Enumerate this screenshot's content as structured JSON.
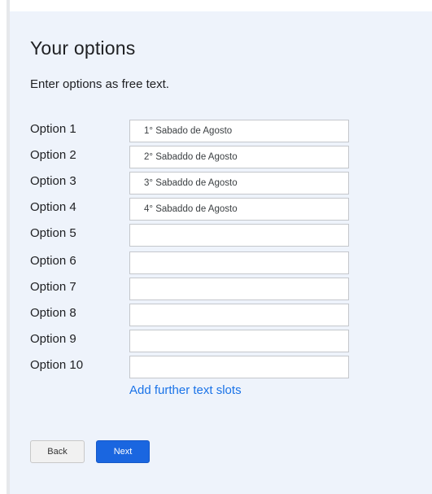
{
  "page": {
    "title": "Your options",
    "instructions": "Enter options as free text."
  },
  "options": [
    {
      "label": "Option 1",
      "value": "1° Sabado de Agosto"
    },
    {
      "label": "Option 2",
      "value": "2° Sabaddo de Agosto"
    },
    {
      "label": "Option 3",
      "value": "3° Sabaddo de Agosto"
    },
    {
      "label": "Option 4",
      "value": "4° Sabaddo de Agosto"
    },
    {
      "label": "Option 5",
      "value": ""
    },
    {
      "label": "Option 6",
      "value": ""
    },
    {
      "label": "Option 7",
      "value": ""
    },
    {
      "label": "Option 8",
      "value": ""
    },
    {
      "label": "Option 9",
      "value": ""
    },
    {
      "label": "Option 10",
      "value": ""
    }
  ],
  "add_slots_label": "Add further text slots",
  "buttons": {
    "back": "Back",
    "next": "Next"
  },
  "colors": {
    "panel_background": "#eef3fb",
    "link": "#1a73e8",
    "primary_button": "#1a66e0"
  }
}
